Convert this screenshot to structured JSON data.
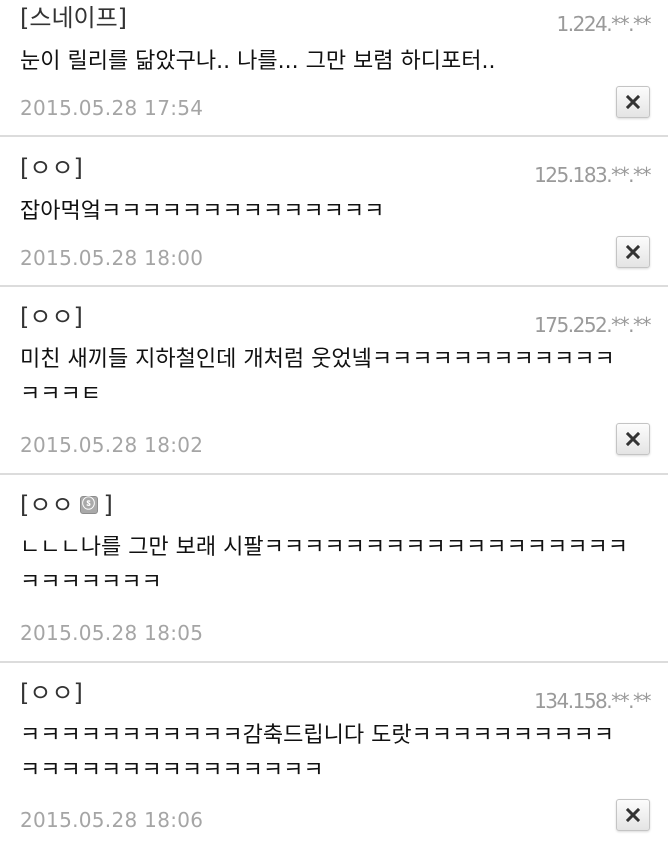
{
  "comments": [
    {
      "nick": "[스네이프]",
      "ip": "1.224.**.**",
      "text": "눈이 릴리를 닮았구나.. 나를... 그만 보렴 하디포터..",
      "date": "2015.05.28  17:54"
    },
    {
      "nick": "[ㅇㅇ]",
      "ip": "125.183.**.**",
      "text": "잡아먹엌ㅋㅋㅋㅋㅋㅋㅋㅋㅋㅋㅋㅋㅋㅋ",
      "date": "2015.05.28  18:00"
    },
    {
      "nick": "[ㅇㅇ]",
      "ip": "175.252.**.**",
      "text": "미친 새끼들 지하철인데 개처럼 웃었넼ㅋㅋㅋㅋㅋㅋㅋㅋㅋㅋㅋㅋㅋㅋㅋㅌ",
      "date": "2015.05.28  18:02"
    },
    {
      "nick_prefix": "[ㅇㅇ",
      "nick_suffix": "]",
      "badge_icon": "fixed-nick-badge-icon",
      "ip": "",
      "text": "ㄴㄴㄴ나를 그만 보래 시팔ㅋㅋㅋㅋㅋㅋㅋㅋㅋㅋㅋㅋㅋㅋㅋㅋㅋㅋㅋㅋㅋㅋㅋㅋㅋ",
      "date": "2015.05.28  18:05"
    },
    {
      "nick": "[ㅇㅇ]",
      "ip": "134.158.**.**",
      "text": "ㅋㅋㅋㅋㅋㅋㅋㅋㅋㅋㅋ감축드립니다 도랏ㅋㅋㅋㅋㅋㅋㅋㅋㅋㅋㅋㅋㅋㅋㅋㅋㅋㅋㅋㅋㅋㅋㅋㅋㅋ",
      "date": "2015.05.28  18:06"
    }
  ],
  "delete_icon": "close-icon"
}
